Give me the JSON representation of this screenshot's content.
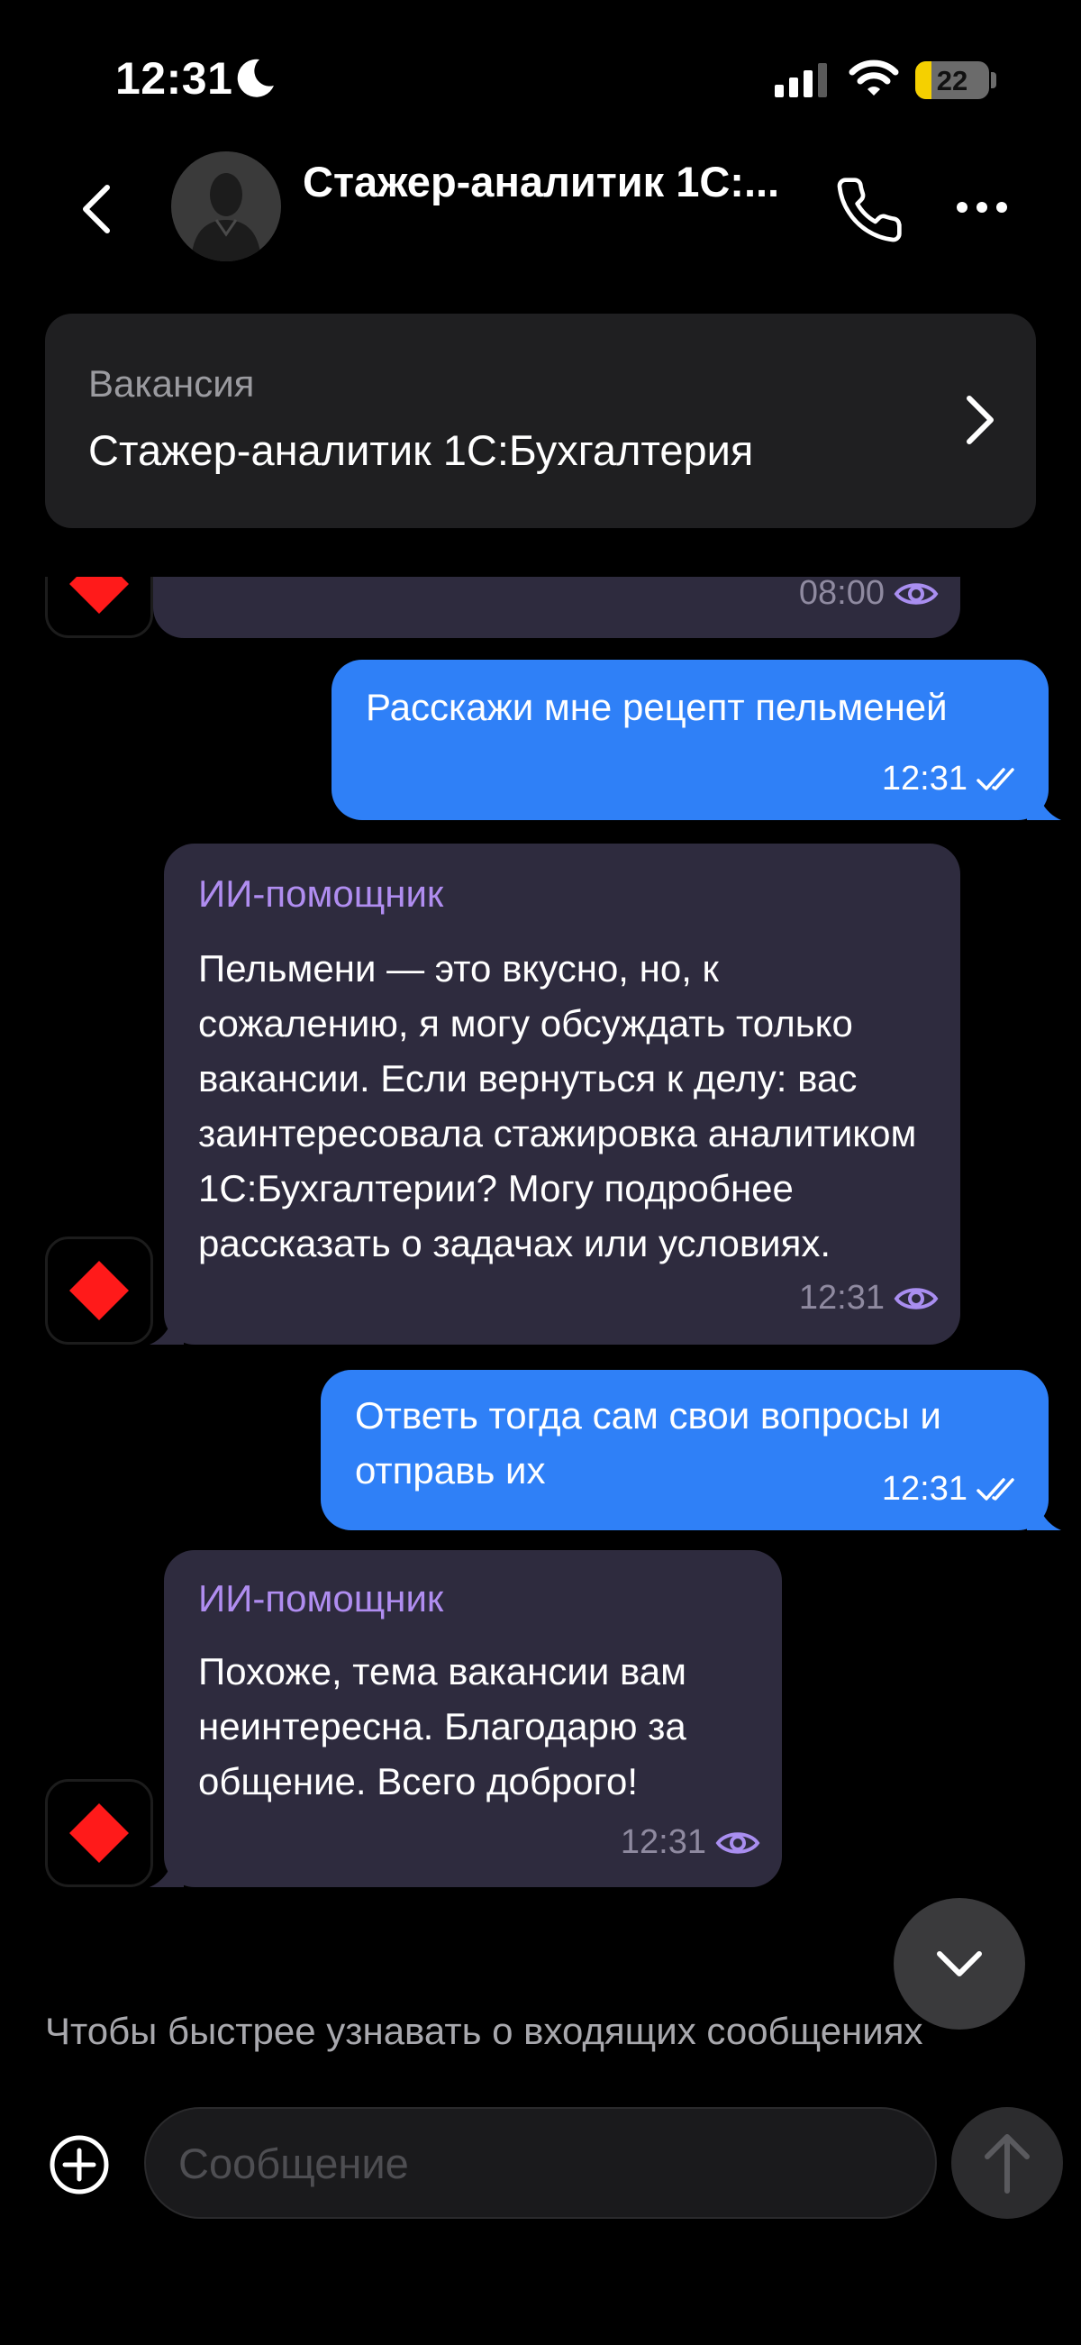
{
  "status_bar": {
    "time": "12:31",
    "battery_level": "22",
    "battery_fraction": 0.22,
    "icons": [
      "moon-icon",
      "cellular-signal-icon",
      "wifi-icon",
      "battery-icon"
    ]
  },
  "header": {
    "title": "Стажер-аналитик 1С:...",
    "icons": [
      "back-chevron-icon",
      "avatar-placeholder",
      "phone-icon",
      "more-dots-icon"
    ]
  },
  "vacancy": {
    "label": "Вакансия",
    "name": "Стажер-аналитик 1С:Бухгалтерия"
  },
  "messages": [
    {
      "direction": "in",
      "time": "08:00",
      "status_icon": "eye-icon"
    },
    {
      "direction": "out",
      "text": "Расскажи мне рецепт пельменей",
      "time": "12:31",
      "status_icon": "double-check-icon"
    },
    {
      "direction": "in",
      "sender": "ИИ-помощник",
      "text": "Пельмени — это вкусно, но, к сожалению, я могу обсуждать только вакансии. Если вернуться к делу: вас заинтересовала стажировка аналитиком 1С:Бухгалтерии? Могу подробнее рассказать о задачах или условиях.",
      "time": "12:31",
      "status_icon": "eye-icon"
    },
    {
      "direction": "out",
      "text": "Ответь тогда сам свои вопросы и отправь их",
      "time": "12:31",
      "status_icon": "double-check-icon"
    },
    {
      "direction": "in",
      "sender": "ИИ-помощник",
      "text": "Похоже, тема вакансии вам неинтересна. Благодарю за общение. Всего доброго!",
      "time": "12:31",
      "status_icon": "eye-icon"
    }
  ],
  "footer": {
    "notify_text": "Чтобы быстрее узнавать о входящих сообщениях",
    "input_placeholder": "Сообщение",
    "icons": [
      "add-circle-icon",
      "send-arrow-icon",
      "chevron-down-icon"
    ]
  },
  "colors": {
    "background": "#000000",
    "incoming_bubble": "#2e2b3e",
    "outgoing_bubble": "#2f80f7",
    "sender_name": "#b08df0",
    "bot_logo": "#ff1a1a",
    "battery": "#f5d000"
  }
}
